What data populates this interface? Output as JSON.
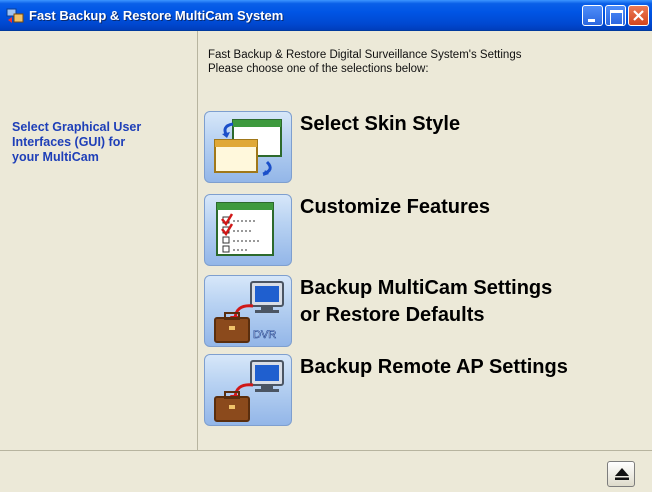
{
  "window": {
    "title": "Fast Backup & Restore MultiCam System"
  },
  "sidebar": {
    "description": "Select Graphical User Interfaces (GUI) for your MultiCam"
  },
  "main": {
    "intro_line1": "Fast Backup & Restore Digital Surveillance System's Settings",
    "intro_line2": "Please choose one of the selections below:",
    "options": [
      {
        "label": "Select Skin Style",
        "icon": "skin-windows-icon"
      },
      {
        "label": "Customize Features",
        "icon": "checklist-icon"
      },
      {
        "label": "Backup MultiCam Settings\nor Restore Defaults",
        "icon": "dvr-backup-icon",
        "badge": "DVR"
      },
      {
        "label": "Backup Remote AP Settings",
        "icon": "remote-backup-icon"
      }
    ]
  },
  "colors": {
    "titlebar": "#0055e5",
    "sidebar_text": "#1e3fb8",
    "background": "#ece9d8"
  }
}
